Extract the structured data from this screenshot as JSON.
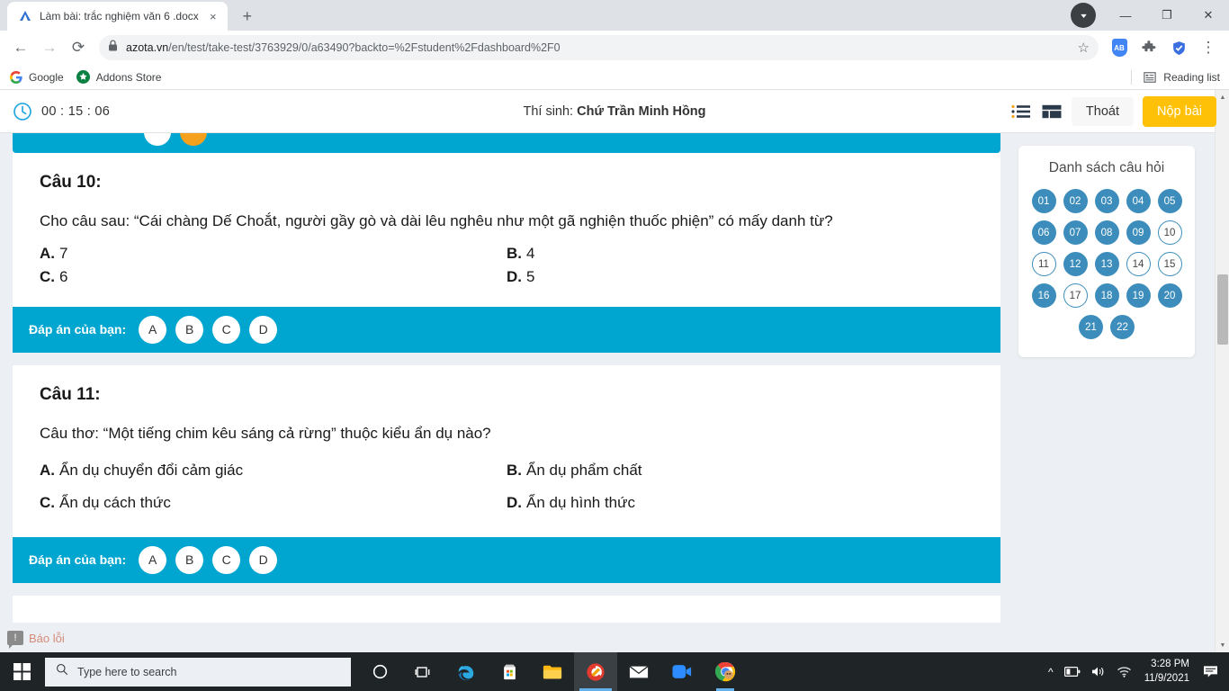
{
  "browser": {
    "tab": {
      "title": "Làm bài: trắc nghiệm văn 6 .docx",
      "favicon": "azota-logo-icon",
      "close": "×"
    },
    "newtab_label": "+",
    "window_controls": {
      "minimize": "—",
      "maximize": "❐",
      "close": "✕"
    },
    "nav": {
      "back": "←",
      "forward": "→",
      "reload": "⟳",
      "lock": "lock-icon"
    },
    "omnibox": {
      "url_domain": "azota.vn",
      "url_path": "/en/test/take-test/3763929/0/a63490?backto=%2Fstudent%2Fdashboard%2F0",
      "star": "☆"
    },
    "extensions": {
      "adblock_label": "AB",
      "puzzle": "puzzle-icon",
      "shield": "shield-check-icon",
      "menu": "⋮"
    },
    "bookmarks": [
      {
        "label": "Google",
        "icon": "google-icon"
      },
      {
        "label": "Addons Store",
        "icon": "addons-store-icon"
      }
    ],
    "reading_list": {
      "label": "Reading list",
      "icon": "reading-list-icon"
    }
  },
  "appbar": {
    "timer": "00 : 15 : 06",
    "timer_icon": "clock-icon",
    "candidate_prefix": "Thí sinh: ",
    "candidate_name": "Chứ Trần Minh Hồng",
    "view_list_icon": "list-view-icon",
    "view_grid_icon": "grid-view-icon",
    "exit_label": "Thoát",
    "submit_label": "Nộp bài"
  },
  "questions": [
    {
      "title": "Câu 10:",
      "text": "Cho câu sau: “Cái chàng Dế Choắt, người gầy gò và dài lêu nghêu như một gã nghiện thuốc phiện” có mấy danh từ?",
      "options": [
        {
          "label": "A.",
          "text": "7"
        },
        {
          "label": "B.",
          "text": "4"
        },
        {
          "label": "C.",
          "text": "6"
        },
        {
          "label": "D.",
          "text": "5"
        }
      ],
      "answer_bar_label": "Đáp án của bạn:",
      "answer_choices": [
        "A",
        "B",
        "C",
        "D"
      ]
    },
    {
      "title": "Câu 11:",
      "text": "Câu thơ: “Một tiếng chim kêu sáng cả rừng” thuộc kiểu ẩn dụ nào?",
      "options": [
        {
          "label": "A.",
          "text": "Ẩn dụ chuyển đổi cảm giác"
        },
        {
          "label": "B.",
          "text": "Ẩn dụ phẩm chất"
        },
        {
          "label": "C.",
          "text": "Ẩn dụ cách thức"
        },
        {
          "label": "D.",
          "text": "Ẩn dụ hình thức"
        }
      ],
      "answer_bar_label": "Đáp án của bạn:",
      "answer_choices": [
        "A",
        "B",
        "C",
        "D"
      ]
    }
  ],
  "sidebar": {
    "title": "Danh sách câu hỏi",
    "numbers": [
      {
        "n": "01",
        "state": "done"
      },
      {
        "n": "02",
        "state": "done"
      },
      {
        "n": "03",
        "state": "done"
      },
      {
        "n": "04",
        "state": "done"
      },
      {
        "n": "05",
        "state": "done"
      },
      {
        "n": "06",
        "state": "done"
      },
      {
        "n": "07",
        "state": "done"
      },
      {
        "n": "08",
        "state": "done"
      },
      {
        "n": "09",
        "state": "done"
      },
      {
        "n": "10",
        "state": "todo"
      },
      {
        "n": "11",
        "state": "todo"
      },
      {
        "n": "12",
        "state": "done"
      },
      {
        "n": "13",
        "state": "done"
      },
      {
        "n": "14",
        "state": "todo"
      },
      {
        "n": "15",
        "state": "todo"
      },
      {
        "n": "16",
        "state": "done"
      },
      {
        "n": "17",
        "state": "todo"
      },
      {
        "n": "18",
        "state": "done"
      },
      {
        "n": "19",
        "state": "done"
      },
      {
        "n": "20",
        "state": "done"
      },
      {
        "n": "21",
        "state": "done"
      },
      {
        "n": "22",
        "state": "done"
      }
    ]
  },
  "report_widget": {
    "label": "Báo lỗi",
    "icon": "report-error-icon"
  },
  "taskbar": {
    "start": "windows-start-icon",
    "search_placeholder": "Type here to search",
    "search_icon": "search-icon",
    "apps": [
      {
        "name": "cortana-icon"
      },
      {
        "name": "task-view-icon"
      },
      {
        "name": "edge-icon"
      },
      {
        "name": "microsoft-store-icon"
      },
      {
        "name": "file-explorer-icon"
      },
      {
        "name": "cc-cleaner-icon"
      },
      {
        "name": "mail-icon"
      },
      {
        "name": "zoom-icon"
      },
      {
        "name": "chrome-icon"
      }
    ],
    "tray": {
      "chevron": "^",
      "battery": "battery-icon",
      "volume": "volume-icon",
      "wifi": "wifi-icon"
    },
    "time": "3:28 PM",
    "date": "11/9/2021",
    "notification": "notification-icon"
  },
  "colors": {
    "accent_cyan": "#00a6d0",
    "submit_yellow": "#ffc107",
    "qnum_blue": "#3c8dbc",
    "selected_orange": "#f5a11d"
  }
}
